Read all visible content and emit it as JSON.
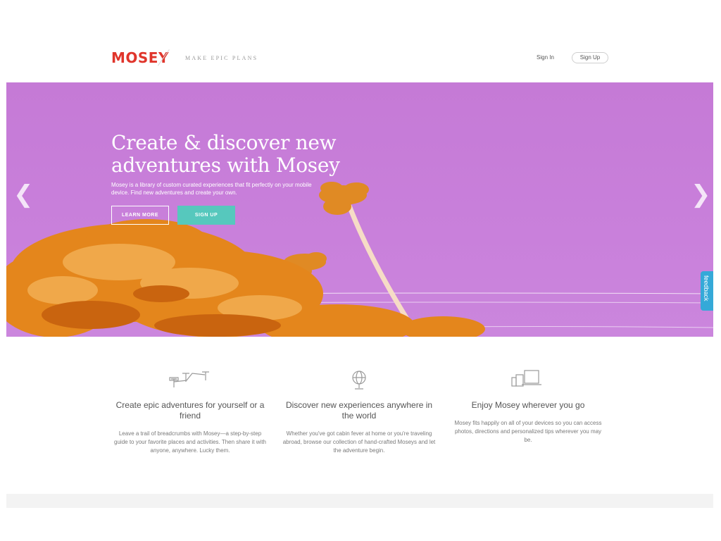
{
  "header": {
    "logo": "MOSEY",
    "tagline": "MAKE EPIC PLANS",
    "signin": "Sign In",
    "signup": "Sign Up"
  },
  "hero": {
    "title": "Create & discover new adventures with Mosey",
    "description": "Mosey is a library of custom curated experiences that fit perfectly on your mobile device. Find new adventures and create your own.",
    "learn_more": "LEARN MORE",
    "sign_up": "SIGN UP",
    "prev_icon": "chevron-left-icon",
    "next_icon": "chevron-right-icon"
  },
  "feedback": "feedback",
  "features": [
    {
      "icon": "breadcrumbs-pins-icon",
      "title": "Create epic adventures for yourself or a friend",
      "text": "Leave a trail of breadcrumbs with Mosey—a step-by-step guide to your favorite places and activities. Then share it with anyone, anywhere. Lucky them."
    },
    {
      "icon": "globe-icon",
      "title": "Discover new experiences anywhere in the world",
      "text": "Whether you've got cabin fever at home or you're traveling abroad, browse our collection of hand-crafted Moseys and let the adventure begin."
    },
    {
      "icon": "devices-icon",
      "title": "Enjoy Mosey wherever you go",
      "text": "Mosey fits happily on all of your devices so you can access photos, directions and personalized tips wherever you may be."
    }
  ],
  "colors": {
    "brand": "#e0352b",
    "accent": "#56c8bd",
    "hero_bg": "#c57ad6",
    "foliage": "#e68a1c",
    "feedback": "#35a9d8"
  }
}
